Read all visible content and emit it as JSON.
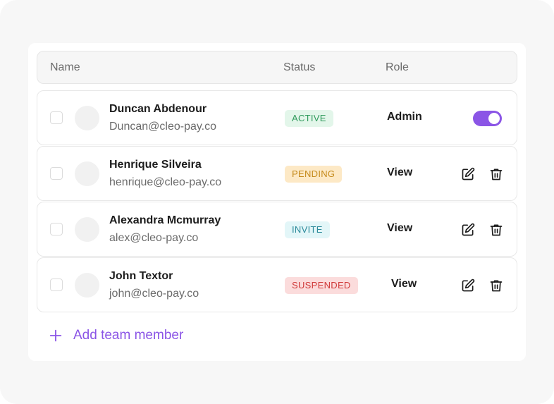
{
  "table": {
    "headers": {
      "name": "Name",
      "status": "Status",
      "role": "Role"
    },
    "rows": [
      {
        "name": "Duncan Abdenour",
        "email": "Duncan@cleo-pay.co",
        "status": "ACTIVE",
        "role": "Admin",
        "toggle_on": true
      },
      {
        "name": "Henrique Silveira",
        "email": "henrique@cleo-pay.co",
        "status": "PENDING",
        "role": "View"
      },
      {
        "name": "Alexandra Mcmurray",
        "email": "alex@cleo-pay.co",
        "status": "INVITE",
        "role": "View"
      },
      {
        "name": "John Textor",
        "email": "john@cleo-pay.co",
        "status": "SUSPENDED",
        "role": "View"
      }
    ]
  },
  "add_member": {
    "label": "Add team member",
    "icon": "plus-icon"
  },
  "icons": {
    "edit": "edit-icon",
    "delete": "trash-icon",
    "toggle": "toggle-switch"
  },
  "colors": {
    "accent": "#8b55e6",
    "active_bg": "#e3f6ea",
    "active_fg": "#2f9a5b",
    "pending_bg": "#fde9c6",
    "pending_fg": "#c58a1b",
    "invite_bg": "#e3f6f8",
    "invite_fg": "#2b8a9a",
    "suspended_bg": "#fbdcdc",
    "suspended_fg": "#d03a3a"
  }
}
